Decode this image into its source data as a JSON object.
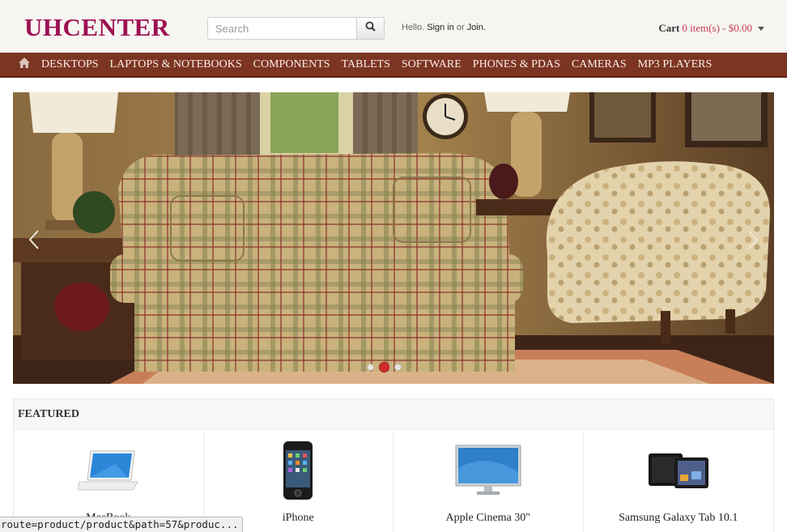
{
  "header": {
    "logo": "UHCENTER",
    "search": {
      "placeholder": "Search",
      "value": ""
    },
    "welcome": {
      "prefix": "Hello.",
      "sign_in": "Sign in",
      "or": "or",
      "join": "Join."
    },
    "cart": {
      "label": "Cart",
      "total": "0 item(s) - $0.00"
    }
  },
  "nav": {
    "home_icon": "home-icon",
    "items": [
      "DESKTOPS",
      "LAPTOPS & NOTEBOOKS",
      "COMPONENTS",
      "TABLETS",
      "SOFTWARE",
      "PHONES & PDAS",
      "CAMERAS",
      "MP3 PLAYERS"
    ]
  },
  "slideshow": {
    "slide_count": 3,
    "active_slide": 2
  },
  "featured": {
    "title": "FEATURED",
    "products": [
      {
        "name": "MacBook",
        "image": "macbook"
      },
      {
        "name": "iPhone",
        "image": "iphone"
      },
      {
        "name": "Apple Cinema 30\"",
        "image": "monitor"
      },
      {
        "name": "Samsung Galaxy Tab 10.1",
        "image": "tablet"
      }
    ]
  },
  "statusbar": {
    "text": "route=product/product&path=57&produc..."
  },
  "colors": {
    "brand": "#9c1152",
    "nav": "#7c3522",
    "cart_total": "#c43a4f",
    "slide_dot_active": "#d02c2c"
  }
}
